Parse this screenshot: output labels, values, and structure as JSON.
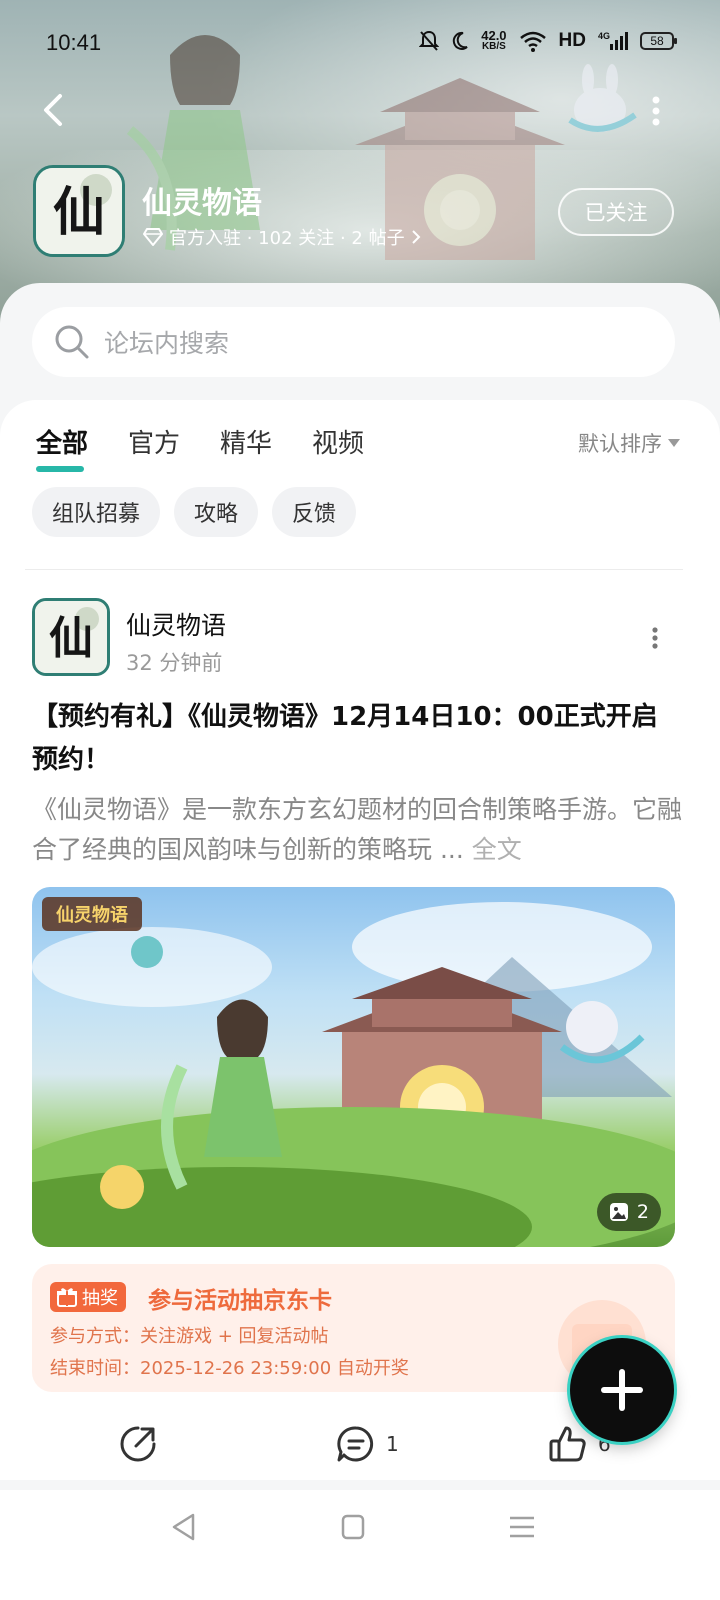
{
  "status_bar": {
    "time": "10:41",
    "net_speed_value": "42.0",
    "net_speed_unit": "KB/S",
    "hd_label": "HD",
    "signal_label": "4G",
    "battery": "58"
  },
  "forum": {
    "logo_char": "仙",
    "title": "仙灵物语",
    "meta": "官方入驻 · 102 关注 · 2 帖子",
    "follow_label": "已关注"
  },
  "search": {
    "placeholder": "论坛内搜索"
  },
  "tabs": [
    {
      "label": "全部",
      "active": true
    },
    {
      "label": "官方"
    },
    {
      "label": "精华"
    },
    {
      "label": "视频"
    }
  ],
  "sort_label": "默认排序",
  "chips": [
    "组队招募",
    "攻略",
    "反馈"
  ],
  "post": {
    "author": "仙灵物语",
    "time": "32 分钟前",
    "title": "【预约有礼】《仙灵物语》12月14日10：00正式开启预约！",
    "body": "《仙灵物语》是一款东方玄幻题材的回合制策略手游。它融合了经典的国风韵味与创新的策略玩",
    "ellipsis": " ... ",
    "full_text": "全文",
    "image_logo_text": "仙灵物语",
    "image_count": "2",
    "lottery": {
      "tag": "抽奖",
      "title": "参与活动抽京东卡",
      "method": "参与方式：关注游戏 + 回复活动帖",
      "end_time": "结束时间：2025-12-26 23:59:00 自动开奖"
    },
    "actions": {
      "comments": "1",
      "likes": "6"
    }
  },
  "colors": {
    "accent": "#27b7a8",
    "lottery_orange": "#ee6a3c"
  }
}
